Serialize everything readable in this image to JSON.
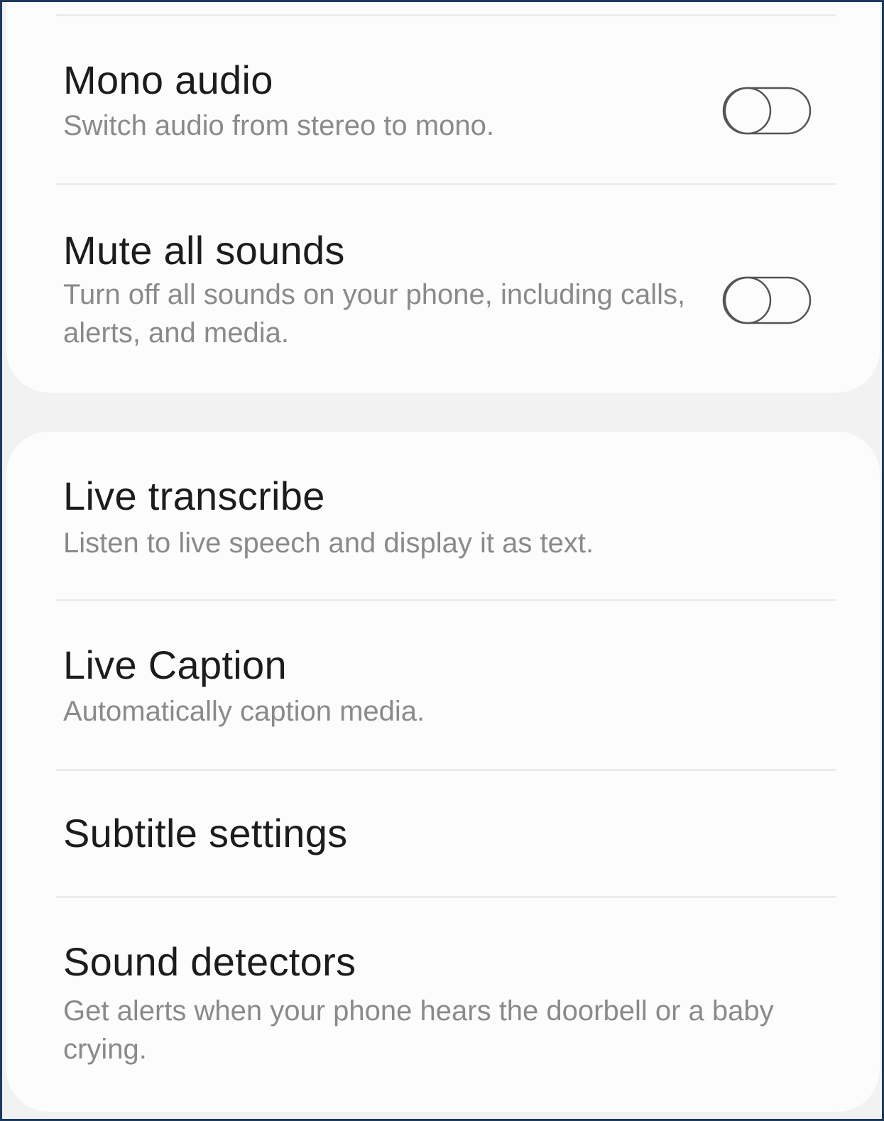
{
  "sound_settings": {
    "mono_audio": {
      "title": "Mono audio",
      "description": "Switch audio from stereo to mono.",
      "toggle_state": "off"
    },
    "mute_all_sounds": {
      "title": "Mute all sounds",
      "description": "Turn off all sounds on your phone, including calls, alerts, and media.",
      "toggle_state": "off"
    }
  },
  "hearing_enhancements": {
    "live_transcribe": {
      "title": "Live transcribe",
      "description": "Listen to live speech and display it as text."
    },
    "live_caption": {
      "title": "Live Caption",
      "description": "Automatically caption media."
    },
    "subtitle_settings": {
      "title": "Subtitle settings"
    },
    "sound_detectors": {
      "title": "Sound detectors",
      "description": "Get alerts when your phone hears the doorbell or a baby crying."
    }
  },
  "colors": {
    "frame_border": "#1b3a5e",
    "background": "#f2f2f2",
    "card": "#fcfcfc",
    "title_text": "#1c1c1c",
    "description_text": "#8a8a8a",
    "toggle_outline": "#555555"
  },
  "icons": {
    "toggle": "toggle-off-icon"
  }
}
